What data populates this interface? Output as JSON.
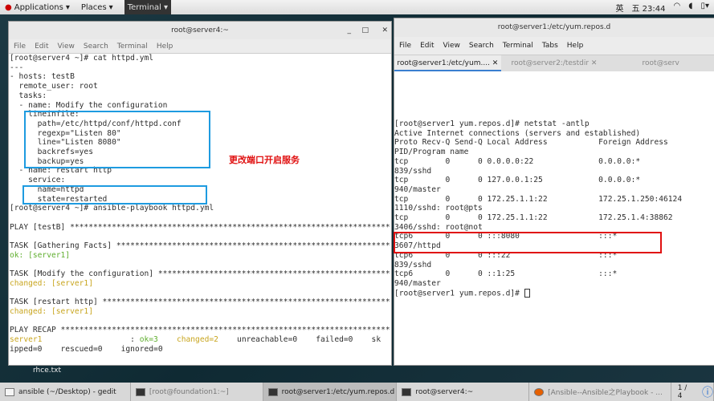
{
  "topbar": {
    "applications": "Applications",
    "places": "Places",
    "terminal": "Terminal",
    "input_method": "英",
    "clock": "五 23:44",
    "icons": [
      "wifi-icon",
      "volume-icon",
      "battery-icon"
    ]
  },
  "left_window": {
    "title": "root@server4:~",
    "menu": [
      "File",
      "Edit",
      "View",
      "Search",
      "Terminal",
      "Help"
    ],
    "lines": [
      [
        {
          "t": "[root@server4 ~]# cat httpd.yml"
        }
      ],
      [
        {
          "t": "---"
        }
      ],
      [
        {
          "t": "- hosts: testB"
        }
      ],
      [
        {
          "t": "  remote_user: root"
        }
      ],
      [
        {
          "t": "  tasks:"
        }
      ],
      [
        {
          "t": "  - name: Modify the configuration"
        }
      ],
      [
        {
          "t": "    lineinfile:"
        }
      ],
      [
        {
          "t": "      path=/etc/httpd/conf/httpd.conf"
        }
      ],
      [
        {
          "t": "      regexp=\"Listen 80\""
        }
      ],
      [
        {
          "t": "      line=\"Listen 8080\""
        }
      ],
      [
        {
          "t": "      backrefs=yes"
        }
      ],
      [
        {
          "t": "      backup=yes"
        }
      ],
      [
        {
          "t": "  - name: restart http"
        }
      ],
      [
        {
          "t": "    service:"
        }
      ],
      [
        {
          "t": "      name=httpd"
        }
      ],
      [
        {
          "t": "      state=restarted"
        }
      ],
      [
        {
          "t": "[root@server4 ~]# ansible-playbook httpd.yml"
        }
      ],
      [
        {
          "t": ""
        }
      ],
      [
        {
          "t": "PLAY [testB] ***************************************************************************"
        }
      ],
      [
        {
          "t": ""
        }
      ],
      [
        {
          "t": "TASK [Gathering Facts] *****************************************************************"
        }
      ],
      [
        {
          "t": "ok: [server1]",
          "c": "ok"
        }
      ],
      [
        {
          "t": ""
        }
      ],
      [
        {
          "t": "TASK [Modify the configuration] ********************************************************"
        }
      ],
      [
        {
          "t": "changed: [server1]",
          "c": "changed"
        }
      ],
      [
        {
          "t": ""
        }
      ],
      [
        {
          "t": "TASK [restart http] ********************************************************************"
        }
      ],
      [
        {
          "t": "changed: [server1]",
          "c": "changed"
        }
      ],
      [
        {
          "t": ""
        }
      ],
      [
        {
          "t": "PLAY RECAP *****************************************************************************"
        }
      ],
      [
        {
          "t": "server1",
          "c": "changed"
        },
        {
          "t": "                   : "
        },
        {
          "t": "ok=3",
          "c": "ok"
        },
        {
          "t": "    "
        },
        {
          "t": "changed=2",
          "c": "changed"
        },
        {
          "t": "    unreachable=0    failed=0    sk"
        }
      ],
      [
        {
          "t": "ipped=0    rescued=0    ignored=0"
        }
      ]
    ],
    "annotation": "更改端口开启服务"
  },
  "right_window": {
    "title": "root@server1:/etc/yum.repos.d",
    "menu": [
      "File",
      "Edit",
      "View",
      "Search",
      "Terminal",
      "Tabs",
      "Help"
    ],
    "tabs": [
      {
        "label": "root@server1:/etc/yum....",
        "active": true
      },
      {
        "label": "root@server2:/testdir",
        "active": false
      },
      {
        "label": "root@serv",
        "active": false
      }
    ],
    "lines": [
      "[root@server1 yum.repos.d]# netstat -antlp",
      "Active Internet connections (servers and established)",
      "Proto Recv-Q Send-Q Local Address           Foreign Address",
      "PID/Program name",
      "tcp        0      0 0.0.0.0:22              0.0.0.0:*",
      "839/sshd",
      "tcp        0      0 127.0.0.1:25            0.0.0.0:*",
      "940/master",
      "tcp        0      0 172.25.1.1:22           172.25.1.250:46124",
      "1110/sshd: root@pts",
      "tcp        0      0 172.25.1.1:22           172.25.1.4:38862",
      "3406/sshd: root@not",
      "tcp6       0      0 :::8080                 :::*",
      "3607/httpd",
      "tcp6       0      0 :::22                   :::*",
      "839/sshd",
      "tcp6       0      0 ::1:25                  :::*",
      "940/master",
      "[root@server1 yum.repos.d]# "
    ]
  },
  "desktop": {
    "file": "rhce.txt"
  },
  "taskbar": {
    "items": [
      "ansible (~/Desktop) - gedit",
      "[root@foundation1:~]",
      "root@server1:/etc/yum.repos.d",
      "root@server4:~",
      "[Ansible--Ansible之Playbook - ..."
    ],
    "workspace": "1 / 4"
  },
  "colors": {
    "ok": "#5fae2e",
    "changed": "#c8a51e",
    "highlight_blue": "#1e9be0",
    "highlight_red": "#e01010"
  }
}
